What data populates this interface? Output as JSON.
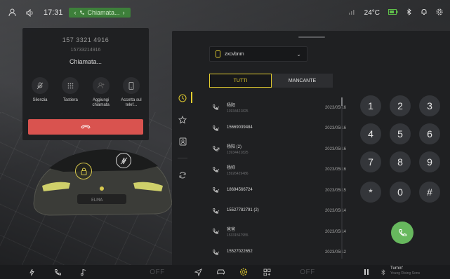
{
  "status_bar": {
    "time": "17:31",
    "call_pill": "Chiamata...",
    "temperature": "24°C"
  },
  "call_card": {
    "name": "157 3321 4916",
    "number": "15733214916",
    "status": "Chiamata...",
    "actions": [
      {
        "label": "Silenzia",
        "icon": "mic-off-icon"
      },
      {
        "label": "Tastiera",
        "icon": "dialpad-icon"
      },
      {
        "label": "Aggiungi chiamata",
        "icon": "add-person-icon"
      },
      {
        "label": "Accetta sul telef...",
        "icon": "phone-device-icon"
      }
    ]
  },
  "phone": {
    "device_name": "zxcvbnm",
    "tabs": [
      "TUTTI",
      "MANCANTE"
    ],
    "active_tab": "TUTTI",
    "calls": [
      {
        "name": "杨阳",
        "number": "13934421825",
        "date": "2023/05/16",
        "dir": "in"
      },
      {
        "name": "15669039484",
        "number": "",
        "date": "2023/05/16",
        "dir": "in"
      },
      {
        "name": "杨阳 (2)",
        "number": "13934421825",
        "date": "2023/05/16",
        "dir": "out"
      },
      {
        "name": "杨帅",
        "number": "15926429486",
        "date": "2023/05/16",
        "dir": "in"
      },
      {
        "name": "18694566724",
        "number": "",
        "date": "2023/05/15",
        "dir": "in"
      },
      {
        "name": "15527782791 (2)",
        "number": "",
        "date": "2023/05/14",
        "dir": "in"
      },
      {
        "name": "爸爸",
        "number": "15331567955",
        "date": "2023/05/14",
        "dir": "in"
      },
      {
        "name": "15527022652",
        "number": "",
        "date": "2023/05/12",
        "dir": "in"
      }
    ],
    "keys": [
      "1",
      "2",
      "3",
      "4",
      "5",
      "6",
      "7",
      "8",
      "9",
      "*",
      "0",
      "#"
    ]
  },
  "bottom_bar": {
    "left_off": "OFF",
    "right_off": "OFF",
    "media_title": "Turnin'",
    "media_sub": "Young Rising Sons"
  },
  "colors": {
    "accent": "#e3cd2f",
    "call_green": "#67b85e",
    "hangup_red": "#d9534f",
    "pill_green": "#3d7f3a"
  }
}
